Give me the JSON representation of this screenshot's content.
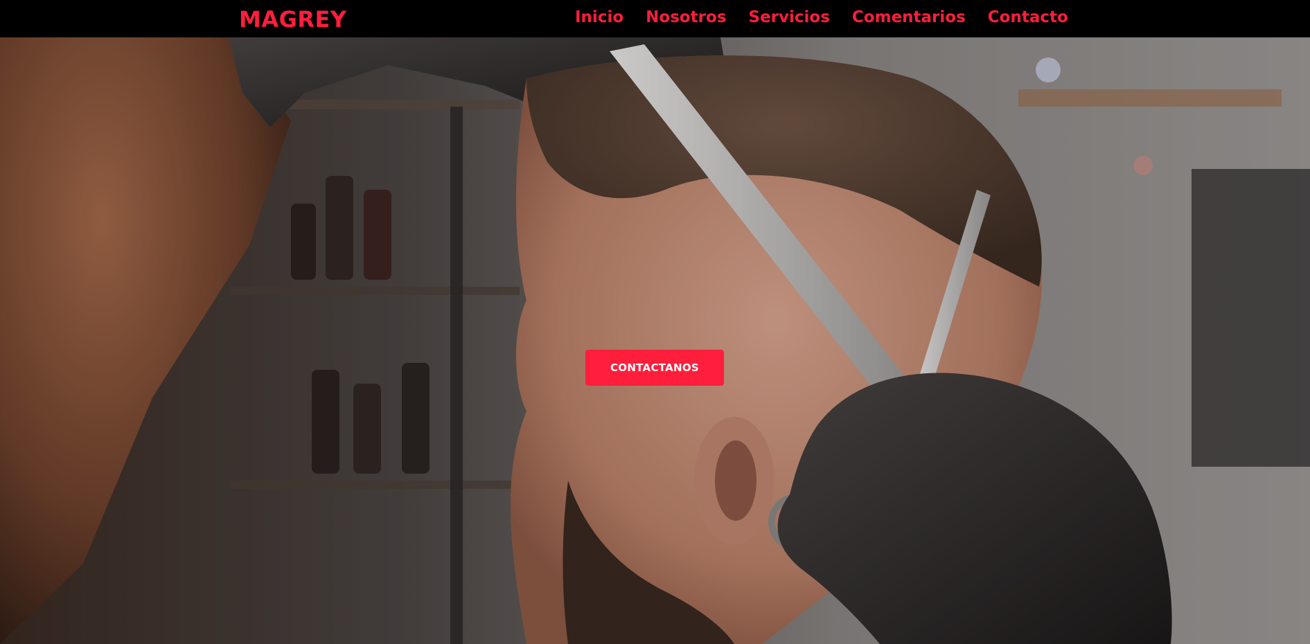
{
  "brand": {
    "name": "MAGREY",
    "color": "#ff1e3c"
  },
  "nav": {
    "items": [
      {
        "label": "Inicio"
      },
      {
        "label": "Nosotros"
      },
      {
        "label": "Servicios"
      },
      {
        "label": "Comentarios"
      },
      {
        "label": "Contacto"
      }
    ]
  },
  "hero": {
    "image": "barber-cutting-hair-photo",
    "cta_label": "CONTACTANOS",
    "cta_color": "#ff1e3c"
  }
}
